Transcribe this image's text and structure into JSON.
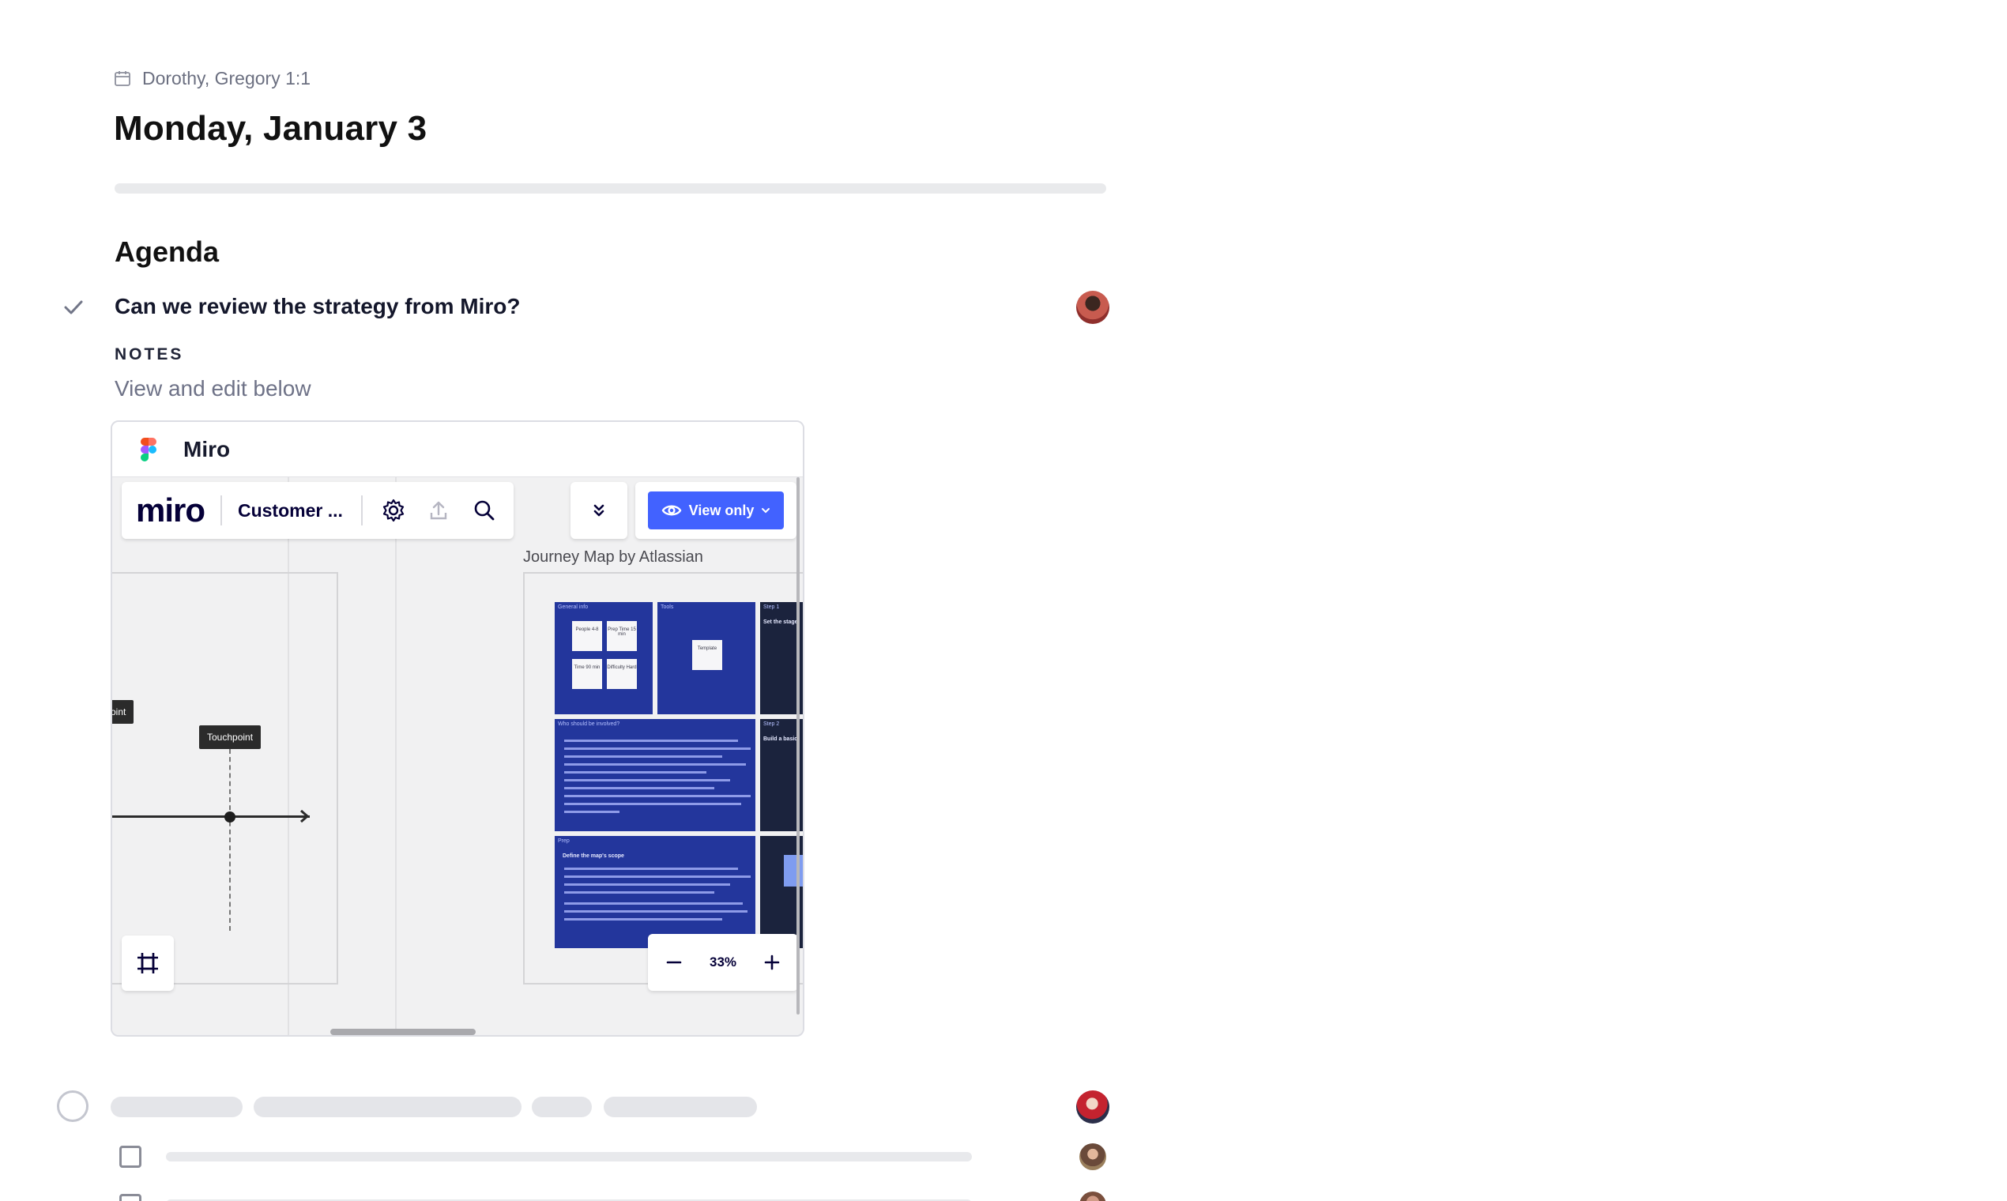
{
  "meeting": {
    "series_label": "Dorothy, Gregory 1:1",
    "icon": "calendar-icon"
  },
  "page": {
    "title": "Monday, January 3"
  },
  "agenda": {
    "heading": "Agenda",
    "items": [
      {
        "title": "Can we review the strategy from Miro?",
        "status": "completed",
        "notes_label": "NOTES",
        "notes_text": "View and edit below"
      }
    ]
  },
  "embed": {
    "provider": "Miro",
    "app": {
      "logo_text": "miro",
      "board_name": "Customer ...",
      "view_mode": "View only",
      "board_title": "Journey Map by Atlassian",
      "zoom": "33%",
      "touchpoint_label": "Touchpoint",
      "touchpoint_label_clipped": "oint",
      "frames": [
        {
          "label": "General info",
          "notes": [
            "People 4-8",
            "Prep Time 15 min",
            "Time 90 min",
            "Difficulty Hard"
          ]
        },
        {
          "label": "Tools",
          "notes": [
            "Template"
          ]
        },
        {
          "label": "Step 1",
          "heading": "Set the stage"
        },
        {
          "label": "Who should be involved?"
        },
        {
          "label": "Step 2",
          "heading": "Build a basic"
        },
        {
          "label": "Prep",
          "heading": "Define the map's scope"
        }
      ]
    }
  },
  "colors": {
    "accent": "#4262ff",
    "miro_frame": "#23369c",
    "text_primary": "#111111",
    "text_secondary": "#6e7287"
  }
}
